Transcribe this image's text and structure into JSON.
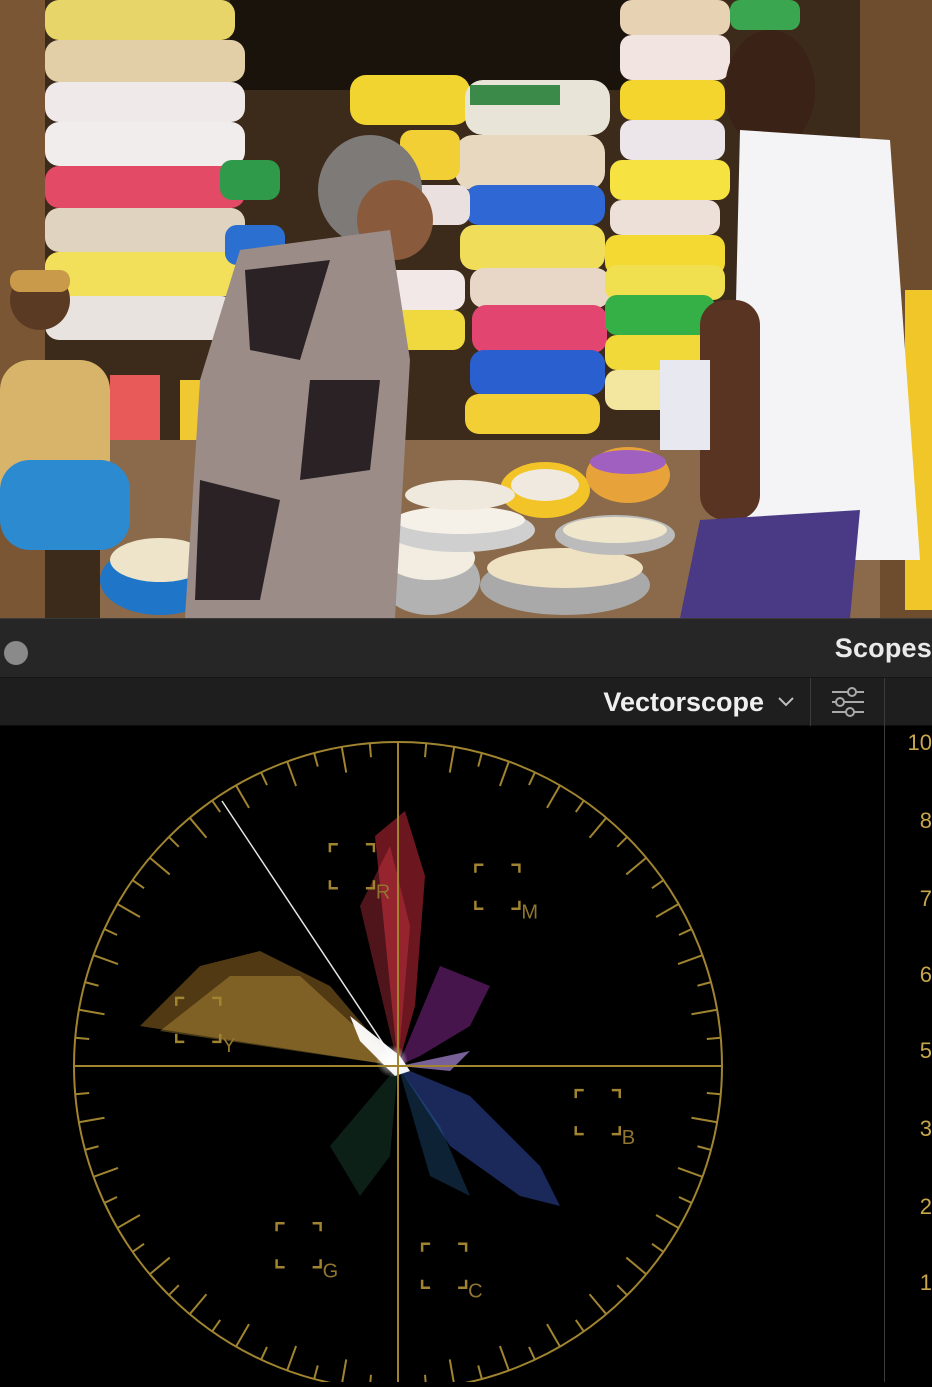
{
  "panel": {
    "title": "Scopes",
    "scope_type": "Vectorscope"
  },
  "icons": {
    "panel_dot": "circle-dot-icon",
    "dropdown": "chevron-down-icon",
    "settings": "sliders-settings-icon"
  },
  "vectorscope": {
    "targets": [
      "R",
      "M",
      "Y",
      "B",
      "G",
      "C"
    ],
    "graticule_color": "#a08430",
    "label_color": "#8f7530"
  },
  "scale": {
    "labels": [
      "10",
      "8",
      "7",
      "6",
      "5",
      "3",
      "2",
      "1"
    ]
  },
  "colors": {
    "header_bg": "#262626",
    "toolbar_bg": "#1e1e1e",
    "scale_text": "#c8a64a"
  }
}
